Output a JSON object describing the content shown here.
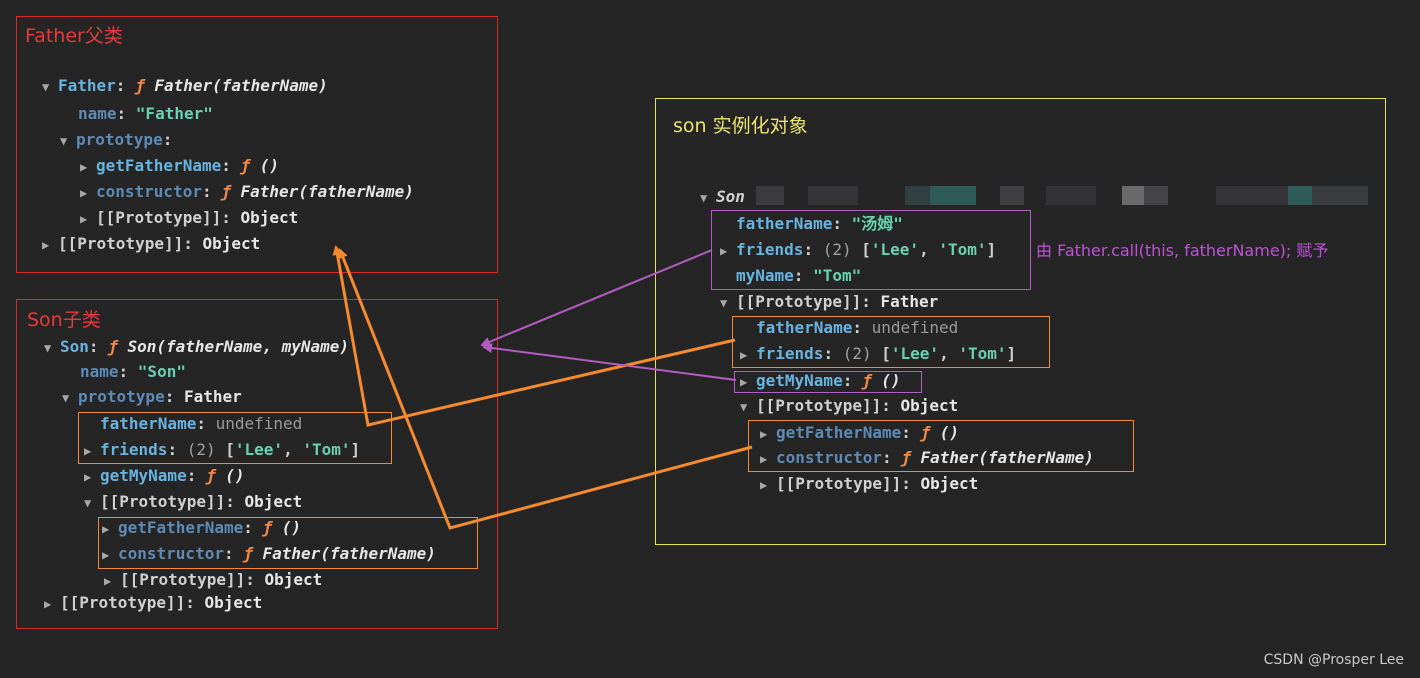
{
  "father_panel": {
    "title": "Father父类",
    "head_key": "Father",
    "head_f": "ƒ",
    "head_sig": "Father(fatherName)",
    "name_key": "name",
    "name_val": "\"Father\"",
    "proto_key": "prototype",
    "getFatherName_key": "getFatherName",
    "func_empty": "()",
    "constructor_key": "constructor",
    "constructor_sig": "Father(fatherName)",
    "inner_proto": "[[Prototype]]",
    "object": "Object",
    "outer_proto": "[[Prototype]]"
  },
  "son_panel": {
    "title": "Son子类",
    "head_key": "Son",
    "head_sig": "Son(fatherName, myName)",
    "name_val": "\"Son\"",
    "proto_val": "Father",
    "fatherName_key": "fatherName",
    "undefined": "undefined",
    "friends_key": "friends",
    "friends_count": "(2)",
    "lee": "'Lee'",
    "tom": "'Tom'",
    "getMyName_key": "getMyName"
  },
  "instance_panel": {
    "title": "son 实例化对象",
    "head": "Son",
    "fatherName_val": "\"汤姆\"",
    "myName_key": "myName",
    "myName_val": "\"Tom\""
  },
  "annotation": "由 Father.call(this, fatherName); 赋予",
  "watermark": "CSDN @Prosper Lee",
  "colors": {
    "background": "#252526",
    "panel_red": "#d52a2a",
    "panel_yellow": "#e9e24b",
    "arrow_orange": "#f58a2e",
    "arrow_purple": "#b25ec0",
    "key": "#68b4e0",
    "string": "#68d1b0",
    "function": "#f28a47"
  }
}
